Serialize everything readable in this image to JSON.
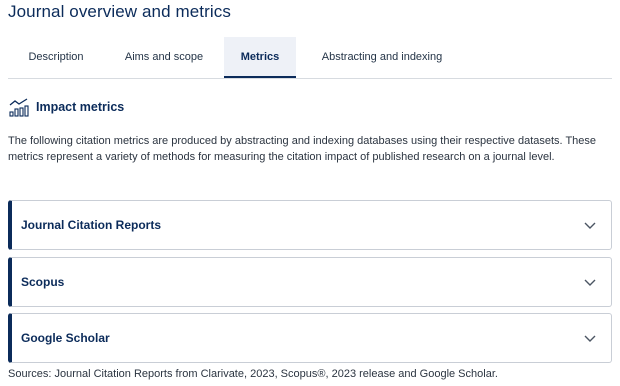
{
  "page_title": "Journal overview and metrics",
  "tabs": [
    {
      "label": "Description"
    },
    {
      "label": "Aims and scope"
    },
    {
      "label": "Metrics"
    },
    {
      "label": "Abstracting and indexing"
    }
  ],
  "active_tab": "Metrics",
  "impact": {
    "heading": "Impact metrics",
    "icon": "bar-chart-trend-icon",
    "description": "The following citation metrics are produced by abstracting and indexing databases using their respective datasets. These metrics represent a variety of methods for measuring the citation impact of published research on a journal level."
  },
  "accordions": [
    {
      "label": "Journal Citation Reports",
      "expanded": false
    },
    {
      "label": "Scopus",
      "expanded": false
    },
    {
      "label": "Google Scholar",
      "expanded": false
    }
  ],
  "sources": "Sources: Journal Citation Reports from Clarivate, 2023, Scopus®, 2023 release and Google Scholar.",
  "colors": {
    "accent": "#0b2b5a",
    "border": "#c9ced6",
    "tab_active_bg": "#eef1f7"
  }
}
